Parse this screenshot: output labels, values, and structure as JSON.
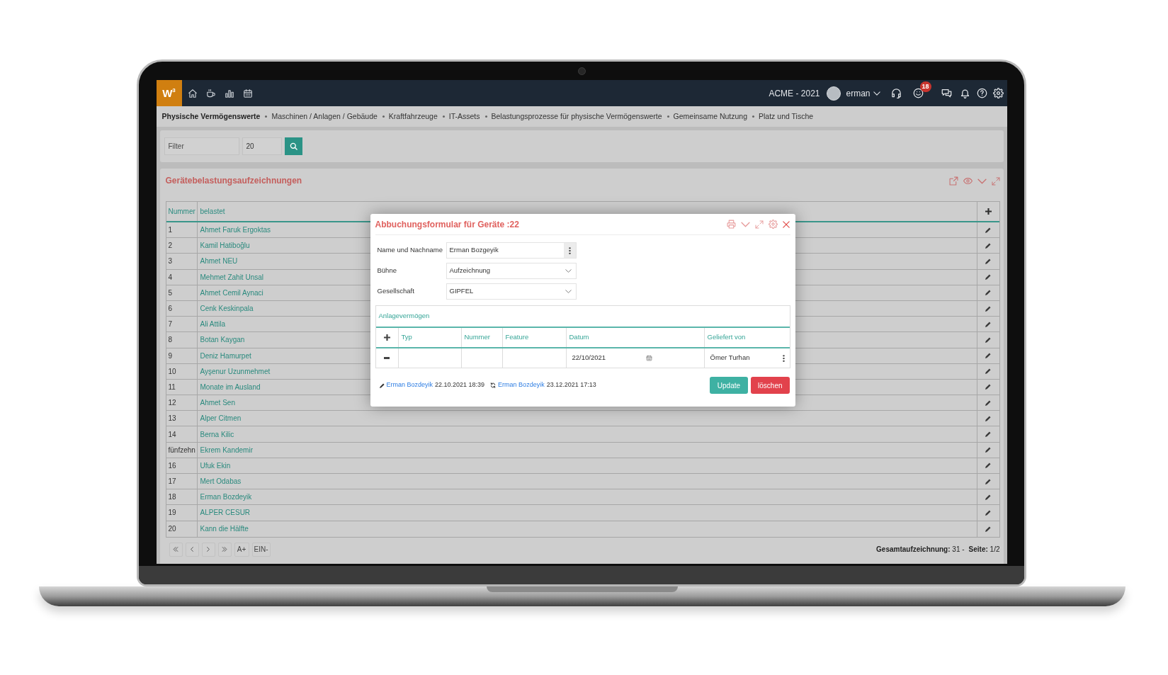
{
  "top_bar": {
    "logo": "W$^{3}$",
    "company": "ACME - 2021",
    "user": "erman",
    "notification_count": "18"
  },
  "breadcrumbs": [
    {
      "label": "Physische Vermögenswerte",
      "selected": true
    },
    {
      "label": "Maschinen / Anlagen / Gebäude",
      "selected": false
    },
    {
      "label": "Kraftfahrzeuge",
      "selected": false
    },
    {
      "label": "IT-Assets",
      "selected": false
    },
    {
      "label": "Belastungsprozesse für physische Vermögenswerte",
      "selected": false
    },
    {
      "label": "Gemeinsame Nutzung",
      "selected": false
    },
    {
      "label": "Platz und Tische",
      "selected": false
    }
  ],
  "filter": {
    "placeholder": "Filter",
    "page_size": "20"
  },
  "records": {
    "title": "Gerätebelastungsaufzeichnungen",
    "columns": [
      "Nummer",
      "belastet"
    ],
    "rows": [
      {
        "number": "1",
        "name": "Ahmet Faruk Ergoktas"
      },
      {
        "number": "2",
        "name": "Kamil Hatiboğlu"
      },
      {
        "number": "3",
        "name": "Ahmet NEU"
      },
      {
        "number": "4",
        "name": "Mehmet Zahit Unsal"
      },
      {
        "number": "5",
        "name": "Ahmet Cemil Aynaci"
      },
      {
        "number": "6",
        "name": "Cenk Keskinpala"
      },
      {
        "number": "7",
        "name": "Ali Attila"
      },
      {
        "number": "8",
        "name": "Botan Kaygan"
      },
      {
        "number": "9",
        "name": "Deniz Hamurpet"
      },
      {
        "number": "10",
        "name": "Ayşenur Uzunmehmet"
      },
      {
        "number": "11",
        "name": "Monate im Ausland"
      },
      {
        "number": "12",
        "name": "Ahmet Sen"
      },
      {
        "number": "13",
        "name": "Alper Citmen"
      },
      {
        "number": "14",
        "name": "Berna Kilic"
      },
      {
        "number": "fünfzehn",
        "name": "Ekrem Kandemir"
      },
      {
        "number": "16",
        "name": "Ufuk Ekin"
      },
      {
        "number": "17",
        "name": "Mert Odabas"
      },
      {
        "number": "18",
        "name": "Erman Bozdeyik"
      },
      {
        "number": "19",
        "name": "ALPER CESUR"
      },
      {
        "number": "20",
        "name": "Kann die Hälfte"
      }
    ]
  },
  "pagination": {
    "buttons": [
      "A+",
      "EIN-"
    ],
    "total": "**Gesamtaufzeichnung:** 31 -",
    "page": "**Seite:** 1/2"
  },
  "dialog": {
    "title": "Abbuchungsformular für Geräte :22",
    "fields": [
      {
        "label": "Name und Nachname",
        "value": "Erman Bozgeyik",
        "kind": "text"
      },
      {
        "label": "Bühne",
        "value": "Aufzeichnung",
        "kind": "select"
      },
      {
        "label": "Gesellschaft",
        "value": "GIPFEL",
        "kind": "select"
      }
    ],
    "assets": {
      "title": "Anlagevermögen",
      "columns": [
        "Typ",
        "Nummer",
        "Feature",
        "Datum",
        "Geliefert von"
      ],
      "rows": [
        {
          "date": "22/10/2021",
          "supplied_by": "Ömer Turhan"
        }
      ]
    },
    "created_by": "Erman Bozdeyik",
    "created_at": "22.10.2021 18:39",
    "updated_by": "Erman Bozdeyik",
    "updated_at": "23.12.2021 17:13",
    "buttons": [
      {
        "label": "Update",
        "kind": "primary"
      },
      {
        "label": "löschen",
        "kind": "danger"
      }
    ]
  }
}
